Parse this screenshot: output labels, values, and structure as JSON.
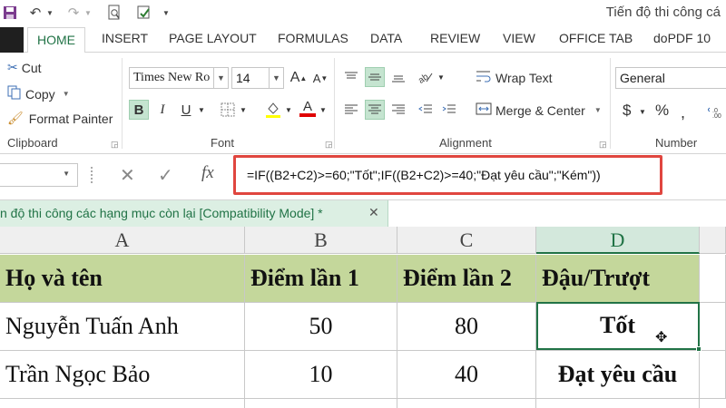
{
  "title_bar": {
    "title": "Tiến độ thi công cá",
    "icons": [
      "save-icon",
      "undo-icon",
      "redo-icon",
      "print-preview-icon",
      "spell-check-icon"
    ]
  },
  "tabs": [
    "HOME",
    "INSERT",
    "PAGE LAYOUT",
    "FORMULAS",
    "DATA",
    "REVIEW",
    "VIEW",
    "OFFICE TAB",
    "doPDF 10"
  ],
  "clipboard": {
    "cut": "Cut",
    "copy": "Copy",
    "format_painter": "Format Painter",
    "label": "Clipboard"
  },
  "font": {
    "name": "Times New Ro",
    "size": "14",
    "grow": "A",
    "shrink": "A",
    "bold": "B",
    "italic": "I",
    "underline": "U",
    "font_color_letter": "A",
    "label": "Font"
  },
  "alignment": {
    "wrap_text": "Wrap Text",
    "merge_center": "Merge & Center",
    "label": "Alignment"
  },
  "number": {
    "format": "General",
    "currency": "$",
    "percent": "%",
    "label": "Number"
  },
  "formula_bar": {
    "fx": "fx",
    "formula": "=IF((B2+C2)>=60;\"Tốt\";IF((B2+C2)>=40;\"Đạt yêu cầu\";\"Kém\"))"
  },
  "workbook_tab": {
    "label": "n độ thi công các hạng mục còn lại  [Compatibility Mode] *",
    "close": "✕"
  },
  "sheet": {
    "columns": [
      "A",
      "B",
      "C",
      "D"
    ],
    "header": [
      "Họ và tên",
      "Điểm lần 1",
      "Điểm lần 2",
      "Đậu/Trượt"
    ],
    "rows": [
      [
        "Nguyễn Tuấn Anh",
        "50",
        "80",
        "Tốt"
      ],
      [
        "Trần Ngọc Bảo",
        "10",
        "40",
        "Đạt yêu cầu"
      ]
    ]
  },
  "colors": {
    "accent": "#217346",
    "header_fill": "#c4d79b",
    "highlight_box": "#e0463f"
  }
}
